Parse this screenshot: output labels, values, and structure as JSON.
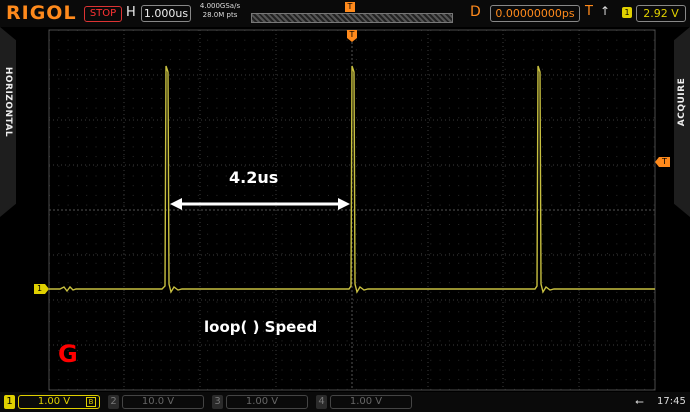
{
  "header": {
    "brand": "RIGOL",
    "run_state": "STOP",
    "h_label": "H",
    "timebase": "1.000us",
    "sample_rate": "4.000GSa/s",
    "memory_depth": "28.0M pts",
    "trigger_marker": "T",
    "delay_label": "D",
    "delay_value": "0.00000000ps",
    "trigger_label": "T",
    "trigger_edge": "↑",
    "trigger_channel": "1",
    "trigger_level": "2.92 V"
  },
  "side_tabs": {
    "left": "HORIZONTAL",
    "right": "ACQUIRE"
  },
  "screen": {
    "trigger_position_marker": "T",
    "channel1_ground_marker": "1",
    "trigger_level_marker": "T",
    "annotation_period": "4.2us",
    "annotation_caption": "loop( ) Speed",
    "annotation_logo": "G"
  },
  "channels": [
    {
      "num": "1",
      "scale": "1.00 V",
      "state": "active",
      "coupling_icon": "B"
    },
    {
      "num": "2",
      "scale": "10.0 V",
      "state": "inactive"
    },
    {
      "num": "3",
      "scale": "1.00 V",
      "state": "inactive"
    },
    {
      "num": "4",
      "scale": "1.00 V",
      "state": "inactive"
    }
  ],
  "status": {
    "usb_icon": "usb-icon",
    "time": "17:45"
  },
  "colors": {
    "brand": "#ff8a1c",
    "channel1": "#e0d000",
    "trace": "#c8c040",
    "stop": "#ff3333",
    "annotation_logo": "#ff0000"
  }
}
